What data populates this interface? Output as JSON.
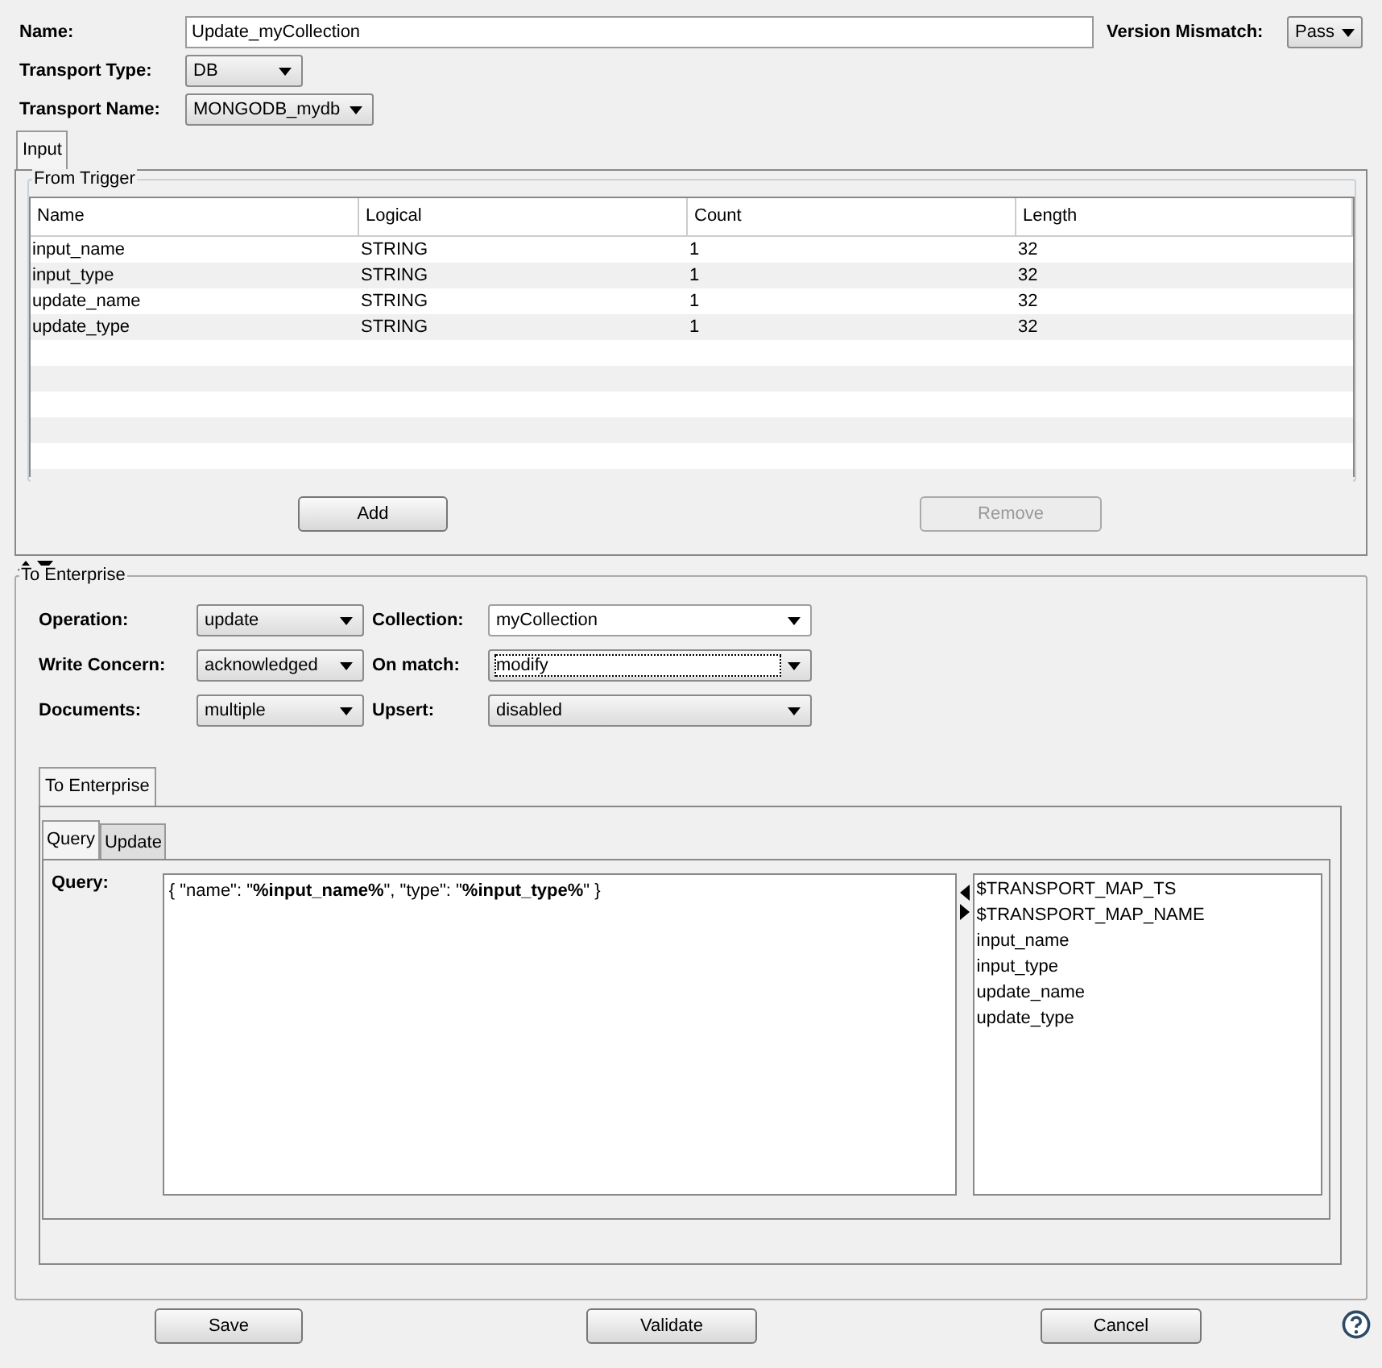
{
  "header": {
    "name": {
      "label": "Name:",
      "value": "Update_myCollection"
    },
    "version_mismatch": {
      "label": "Version Mismatch:",
      "value": "Pass"
    },
    "transport_type": {
      "label": "Transport Type:",
      "value": "DB"
    },
    "transport_name": {
      "label": "Transport Name:",
      "value": "MONGODB_mydb"
    }
  },
  "input_tabs": [
    {
      "label": "Input",
      "selected": true
    }
  ],
  "from_trigger": {
    "title": "From Trigger",
    "columns": [
      "Name",
      "Logical",
      "Count",
      "Length"
    ],
    "rows": [
      [
        "input_name",
        "STRING",
        "1",
        "32"
      ],
      [
        "input_type",
        "STRING",
        "1",
        "32"
      ],
      [
        "update_name",
        "STRING",
        "1",
        "32"
      ],
      [
        "update_type",
        "STRING",
        "1",
        "32"
      ]
    ],
    "buttons": [
      {
        "label": "Add",
        "disabled": false
      },
      {
        "label": "Remove",
        "disabled": true
      }
    ]
  },
  "to_enterprise": {
    "title": "To Enterprise",
    "fields": [
      {
        "label": "Operation:",
        "value": "update",
        "kind": "select",
        "focused": false
      },
      {
        "label": "Collection:",
        "value": "myCollection",
        "kind": "editable",
        "focused": false
      },
      {
        "label": "Write Concern:",
        "value": "acknowledged",
        "kind": "select",
        "focused": false
      },
      {
        "label": "On match:",
        "value": "modify",
        "kind": "select",
        "focused": true
      },
      {
        "label": "Documents:",
        "value": "multiple",
        "kind": "select",
        "focused": false
      },
      {
        "label": "Upsert:",
        "value": "disabled",
        "kind": "select",
        "focused": false
      }
    ],
    "tabs": [
      {
        "label": "To Enterprise",
        "selected": true
      }
    ],
    "sub_tabs": [
      {
        "label": "Query",
        "selected": true
      },
      {
        "label": "Update",
        "selected": false
      }
    ],
    "query": {
      "label": "Query:",
      "value": "{ \"name\": \"**%input_name%**\", \"type\": \"**%input_type%**\" }"
    },
    "variables": [
      "$TRANSPORT_MAP_TS",
      "$TRANSPORT_MAP_NAME",
      "input_name",
      "input_type",
      "update_name",
      "update_type"
    ]
  },
  "buttons": [
    "Save",
    "Validate",
    "Cancel"
  ]
}
